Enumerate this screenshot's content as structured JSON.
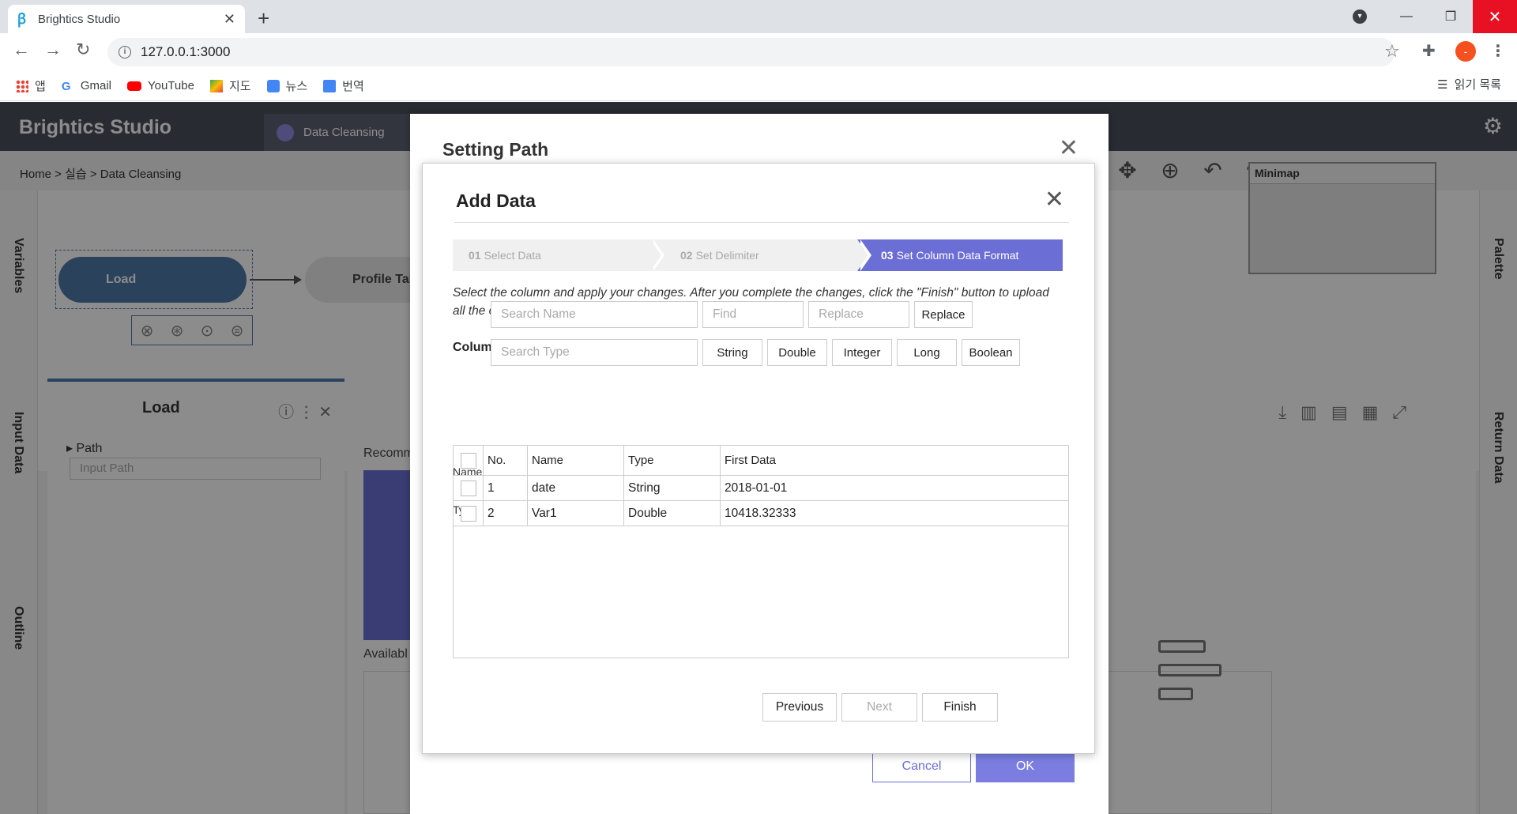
{
  "browser": {
    "tab_title": "Brightics Studio",
    "url": "127.0.0.1:3000",
    "profile_initial": "-",
    "bookmarks": [
      {
        "label": "앱",
        "icon": "apps-grid-icon"
      },
      {
        "label": "Gmail",
        "icon": "google-icon"
      },
      {
        "label": "YouTube",
        "icon": "youtube-icon"
      },
      {
        "label": "지도",
        "icon": "maps-icon"
      },
      {
        "label": "뉴스",
        "icon": "news-icon"
      },
      {
        "label": "번역",
        "icon": "translate-icon"
      }
    ],
    "reading_list": "읽기 목록"
  },
  "app": {
    "logo": "Brightics Studio",
    "active_tab": "Data Cleansing",
    "breadcrumb": "Home > 실습 > Data Cleansing",
    "left_panels": [
      "Variables",
      "Input Data",
      "Outline"
    ],
    "right_panels": [
      "Palette",
      "Return Data"
    ],
    "nodes": {
      "load": "Load",
      "profile": "Profile Tal"
    },
    "properties": {
      "title": "Load",
      "path_label": "Path",
      "path_placeholder": "Input Path"
    },
    "minimap_title": "Minimap",
    "result": {
      "recommended": "Recomm",
      "available": "Availabl"
    }
  },
  "setting_path": {
    "title": "Setting Path",
    "cancel": "Cancel",
    "ok": "OK"
  },
  "add_data": {
    "title": "Add Data",
    "steps": [
      {
        "num": "01",
        "label": "Select Data",
        "active": false
      },
      {
        "num": "02",
        "label": "Set Delimiter",
        "active": false
      },
      {
        "num": "03",
        "label": "Set Column Data Format",
        "active": true
      }
    ],
    "description": "Select the column and apply your changes. After you complete the changes, click the \"Finish\" button to upload all the columns.",
    "section_title": "Column name and type:",
    "name_label": "Name",
    "type_label": "Type",
    "search_name_placeholder": "Search Name",
    "find_placeholder": "Find",
    "replace_placeholder": "Replace",
    "replace_button": "Replace",
    "search_type_placeholder": "Search Type",
    "type_buttons": [
      "String",
      "Double",
      "Integer",
      "Long",
      "Boolean"
    ],
    "table": {
      "headers": [
        "No.",
        "Name",
        "Type",
        "First Data"
      ],
      "rows": [
        {
          "no": "1",
          "name": "date",
          "type": "String",
          "first": "2018-01-01"
        },
        {
          "no": "2",
          "name": "Var1",
          "type": "Double",
          "first": "10418.32333"
        }
      ]
    },
    "previous": "Previous",
    "next": "Next",
    "finish": "Finish"
  },
  "colors": {
    "accent": "#6b6ed4",
    "node_blue": "#4f79a8",
    "header": "#4a4f5c"
  }
}
